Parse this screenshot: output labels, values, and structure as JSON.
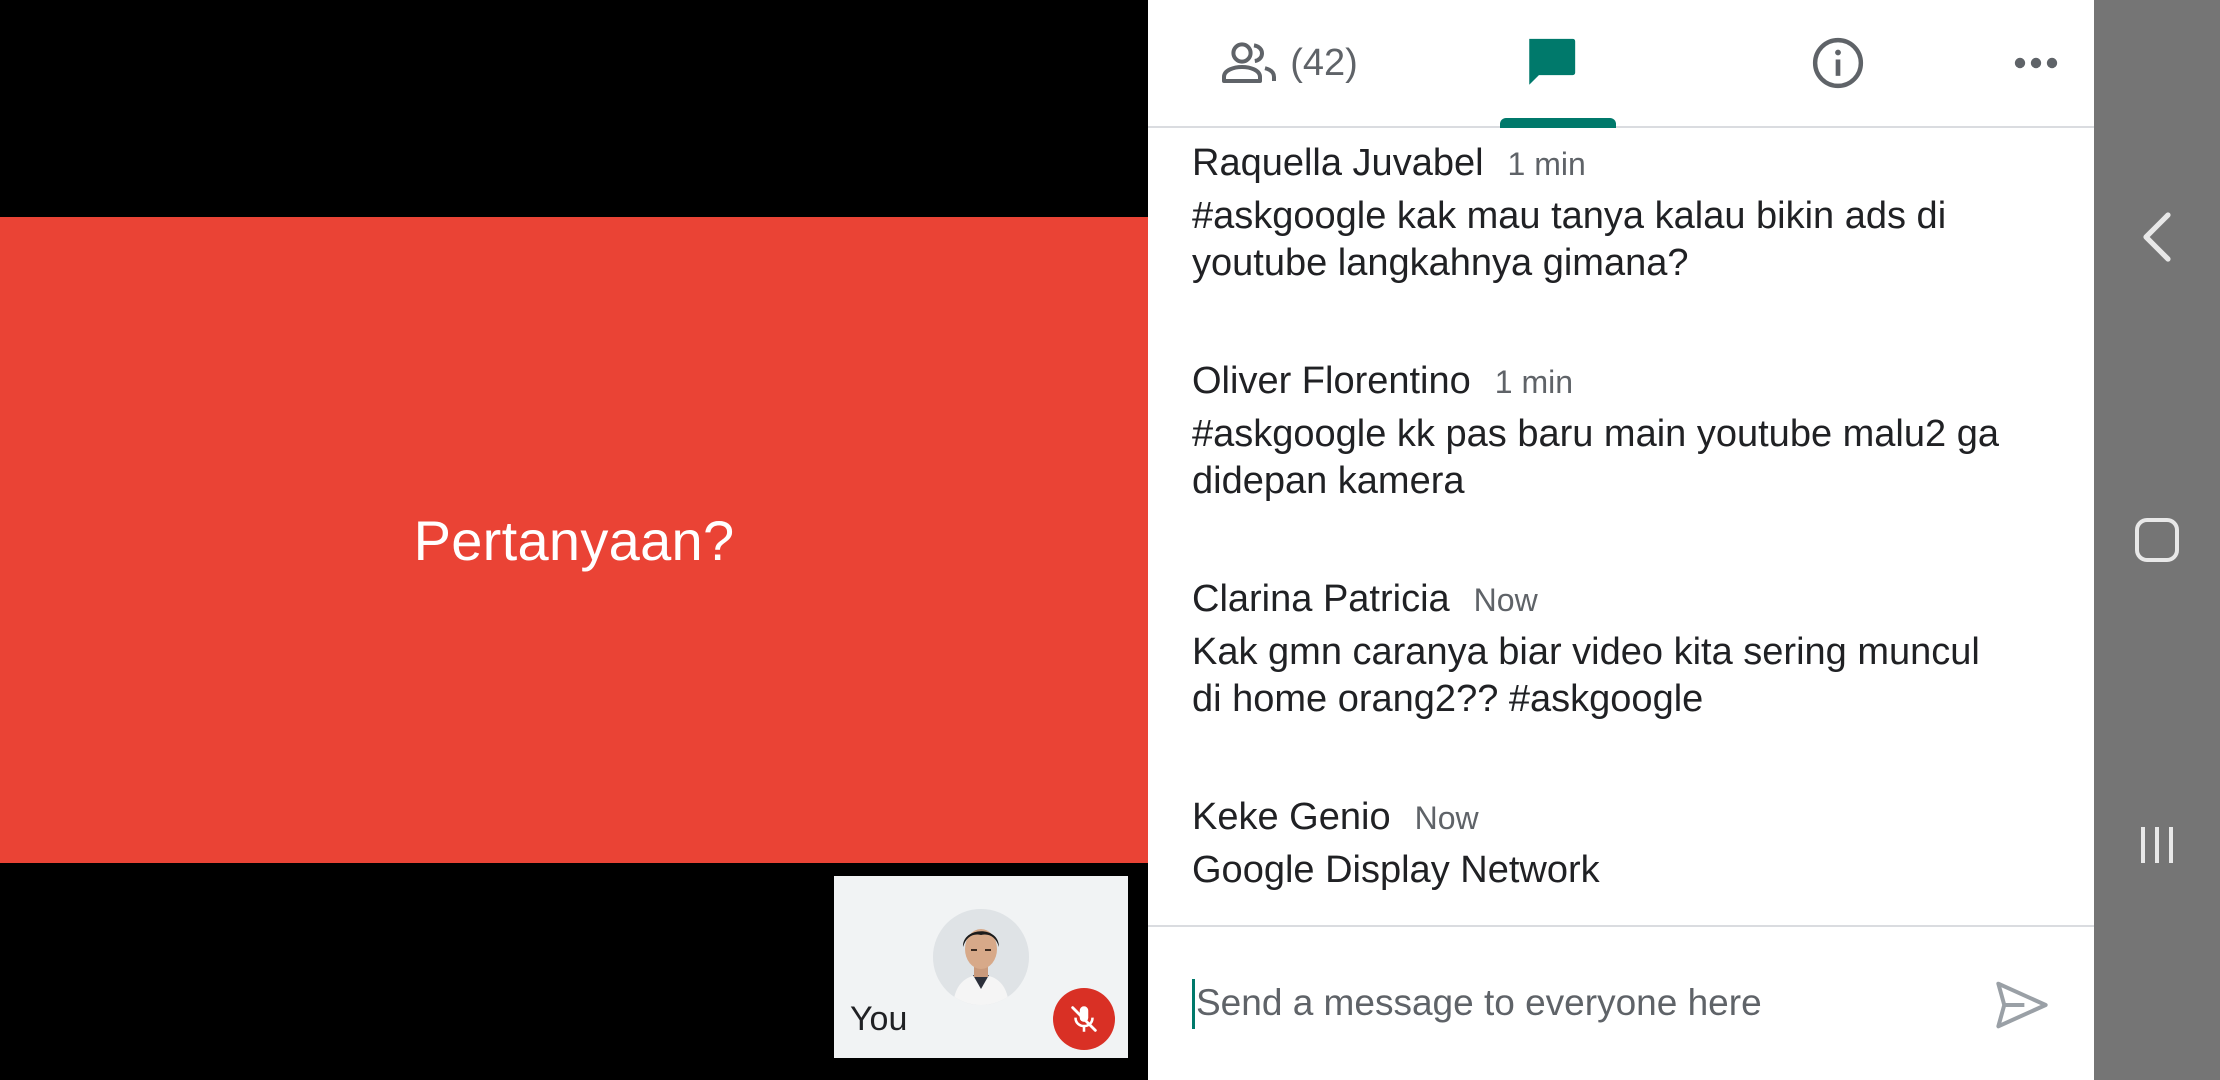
{
  "stage": {
    "slide_text": "Pertanyaan?",
    "slide_color": "#ea4335",
    "self_label": "You",
    "mute_badge_color": "#d93025"
  },
  "tabs": {
    "people_count": "(42)",
    "accent_color": "#00796b",
    "icons": [
      "people-icon",
      "chat-icon",
      "info-icon",
      "more-icon"
    ]
  },
  "messages": [
    {
      "sender": "Raquella Juvabel",
      "time": "1 min",
      "lines": [
        "#askgoogle kak mau tanya kalau bikin ads di",
        "youtube langkahnya gimana?"
      ]
    },
    {
      "sender": "Oliver Florentino",
      "time": "1 min",
      "lines": [
        "#askgoogle kk pas baru main youtube malu2 ga",
        "didepan kamera"
      ]
    },
    {
      "sender": "Clarina Patricia",
      "time": "Now",
      "lines": [
        "Kak gmn caranya biar video kita sering muncul",
        "di home orang2?? #askgoogle"
      ]
    },
    {
      "sender": "Keke Genio",
      "time": "Now",
      "lines": [
        "Google Display Network"
      ]
    }
  ],
  "composer": {
    "placeholder": "Send a message to everyone here"
  },
  "navbar": {
    "icons": [
      "back-icon",
      "home-icon",
      "recents-icon"
    ]
  }
}
